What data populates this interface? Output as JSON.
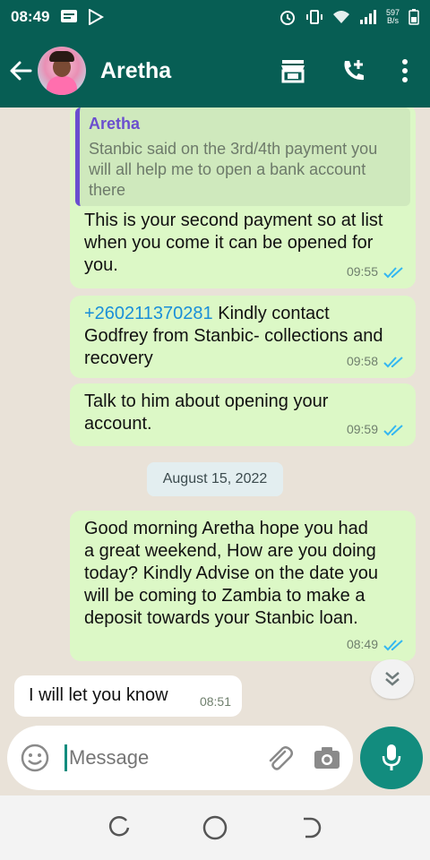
{
  "status_bar": {
    "time": "08:49",
    "speed_value": "597",
    "speed_unit": "B/s",
    "icons": [
      "message-icon",
      "play-store-icon",
      "alarm-icon",
      "vibrate-icon",
      "wifi-icon",
      "signal-icon",
      "battery-icon"
    ]
  },
  "header": {
    "contact_name": "Aretha",
    "actions": [
      "store-icon",
      "add-call-icon",
      "more-icon"
    ]
  },
  "messages": [
    {
      "direction": "out",
      "quote": {
        "name": "Aretha",
        "text": "Stanbic said on the 3rd/4th payment you will all help me to open a bank account there"
      },
      "lines": [
        "This is your second payment so at list",
        "when you come it can be opened for",
        "you."
      ],
      "time": "09:55"
    },
    {
      "direction": "out",
      "link": "+260211370281",
      "lines_after_link": [
        " Kindly contact",
        "Godfrey from Stanbic- collections and",
        "recovery"
      ],
      "time": "09:58"
    },
    {
      "direction": "out",
      "lines": [
        "Talk to him about opening your",
        "account."
      ],
      "time": "09:59"
    },
    {
      "direction": "out",
      "lines": [
        "Good morning Aretha hope you had",
        "a great weekend, How are you doing",
        "today? Kindly Advise on the date you",
        "will be coming to Zambia to make a",
        "deposit towards your Stanbic loan."
      ],
      "time": "08:49"
    },
    {
      "direction": "in",
      "lines": [
        "I will let you know"
      ],
      "time": "08:51"
    }
  ],
  "date_chip": "August 15, 2022",
  "composer": {
    "placeholder": "Message"
  },
  "colors": {
    "header_bg": "#075e54",
    "outgoing_bubble": "#dcf8c6",
    "incoming_bubble": "#ffffff",
    "read_ticks": "#34b7f1",
    "accent": "#128c7e"
  }
}
